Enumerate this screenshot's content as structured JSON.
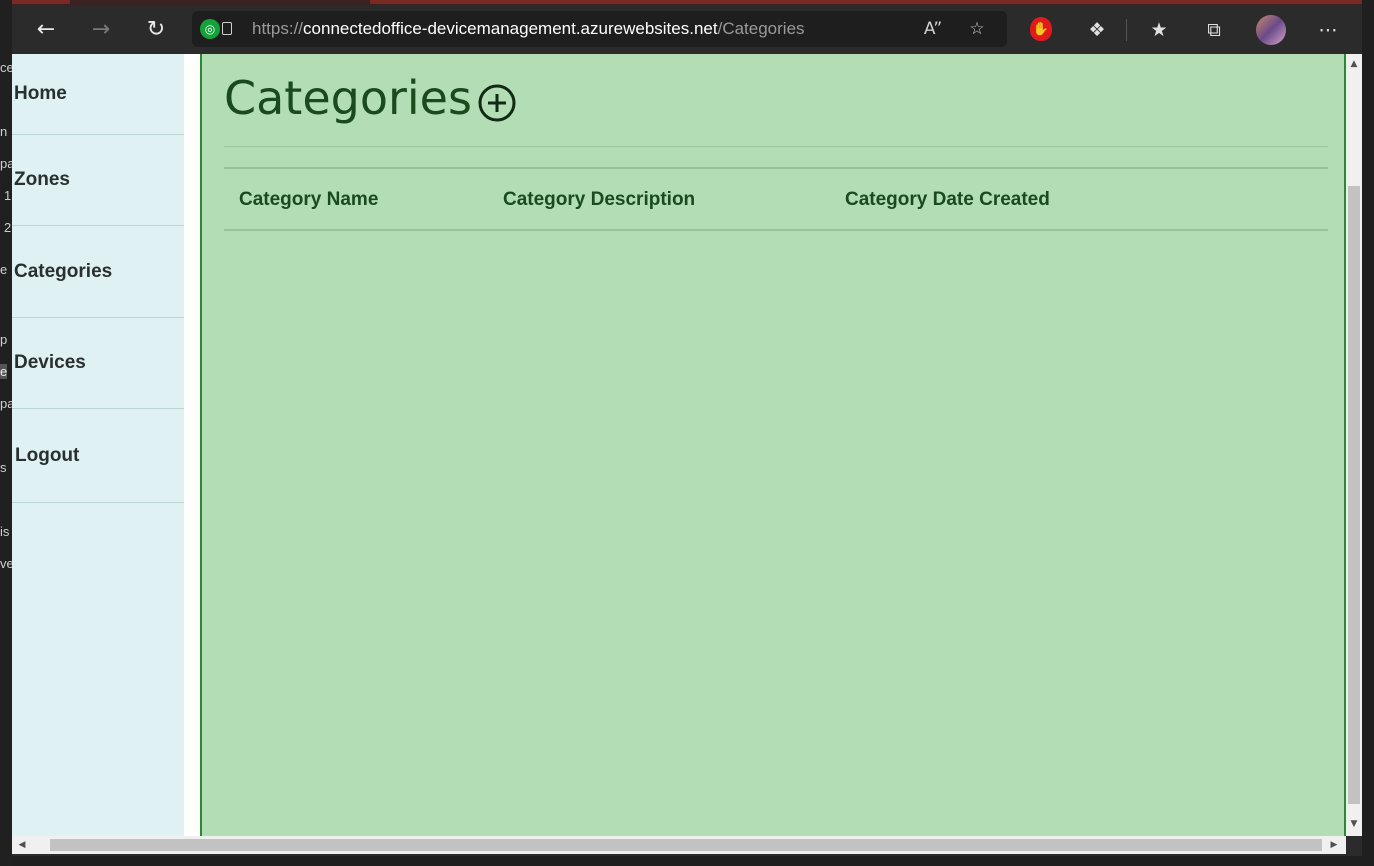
{
  "browser": {
    "url_scheme": "https://",
    "url_host": "connectedoffice-devicemanagement.azurewebsites.net",
    "url_path": "/Categories",
    "icons": [
      "back-arrow-icon",
      "forward-arrow-icon",
      "refresh-icon",
      "site-info-icon",
      "read-aloud-icon",
      "add-favorite-icon",
      "stop-extension-icon",
      "extensions-icon",
      "favorites-icon",
      "collections-icon",
      "profile-avatar",
      "more-menu-icon"
    ]
  },
  "background_window_fragments": [
    "ce",
    "n",
    "pa",
    "1",
    "2",
    "e",
    "p",
    "e",
    "pa",
    "s",
    "is",
    "ve"
  ],
  "sidebar": {
    "items": [
      {
        "label": "Home"
      },
      {
        "label": "Zones"
      },
      {
        "label": "Categories"
      },
      {
        "label": "Devices"
      },
      {
        "label": "Logout"
      }
    ]
  },
  "main": {
    "title": "Categories",
    "table": {
      "columns": [
        "Category Name",
        "Category Description",
        "Category Date Created"
      ],
      "rows": []
    }
  },
  "colors": {
    "sidebar_bg": "#dff1f2",
    "overlay_bg": "#b3ddb5",
    "overlay_border": "#2a8a2f",
    "heading": "#1a4a1e"
  }
}
